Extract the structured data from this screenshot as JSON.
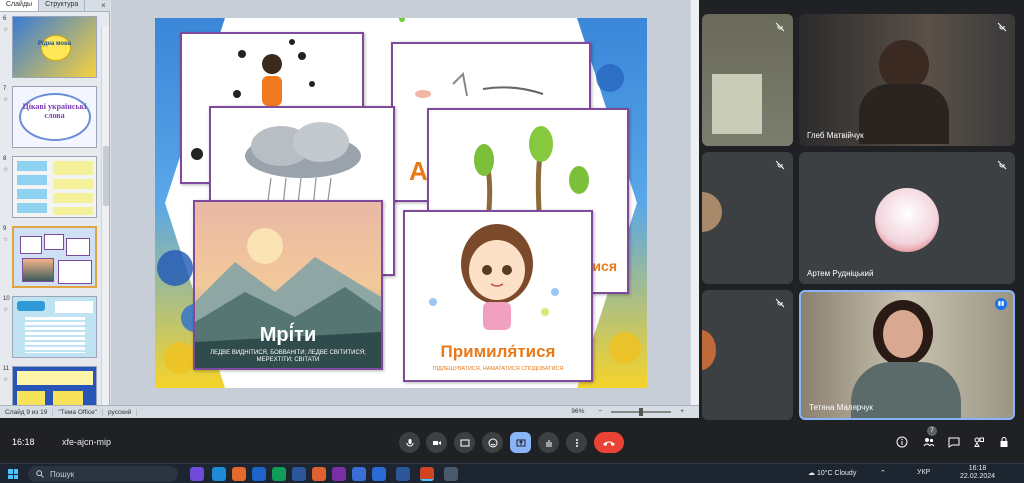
{
  "ppt": {
    "tabs": [
      "Слайды",
      "Структура"
    ],
    "close_glyph": "×",
    "thumbnails": [
      {
        "num": "6",
        "title": "Рідна мова"
      },
      {
        "num": "7",
        "title": "Цікаві українські слова"
      },
      {
        "num": "8",
        "title": ""
      },
      {
        "num": "9",
        "title": ""
      },
      {
        "num": "10",
        "title": ""
      },
      {
        "num": "11",
        "title": ""
      }
    ],
    "status": {
      "slide": "Слайд 9 из 19",
      "theme": "\"Тема Office\"",
      "language": "русский",
      "zoom": "96%"
    },
    "slide": {
      "card_a_word": "А",
      "card_b_word": "тися",
      "card_mriti_word": "Мрі́ти",
      "card_mriti_def": "ЛЕДВЕ ВИДНІТИСЯ, БОВВАНІТИ; ЛЕДВЕ СВІТИТИСЯ; МЕРЕХТІТИ; СВІТАТИ",
      "card_prim_word": "Примиля́тися",
      "card_prim_def": "ПІДЛЕЩУВАТИСЯ, НАМАГАТИСЯ СПОДОБАТИСЯ",
      "accent": "#e87a1a"
    }
  },
  "participants": [
    {
      "name": ""
    },
    {
      "name": "Глеб Матвійчук"
    },
    {
      "name": ""
    },
    {
      "name": "Артем Рудніцький"
    },
    {
      "name": ""
    },
    {
      "name": "Тетяна Малярчук"
    }
  ],
  "meet": {
    "time": "16:18",
    "code": "xfe-ajcn-mip",
    "participant_count": "7",
    "controls": [
      "mic-icon",
      "camera-icon",
      "captions-icon",
      "emoji-icon",
      "present-icon",
      "raise-hand-icon",
      "more-icon",
      "hangup-icon"
    ],
    "right_controls": [
      "info-icon",
      "people-icon",
      "chat-icon",
      "activities-icon",
      "lock-icon"
    ],
    "colors": {
      "bg": "#202124",
      "tile": "#3c4043",
      "hangup": "#ea4335",
      "present": "#8ab4f8"
    }
  },
  "taskbar": {
    "search_placeholder": "Пошук",
    "weather": "10°C  Cloudy",
    "lang": "УКР",
    "time": "16:18",
    "date": "22.02.2024"
  }
}
